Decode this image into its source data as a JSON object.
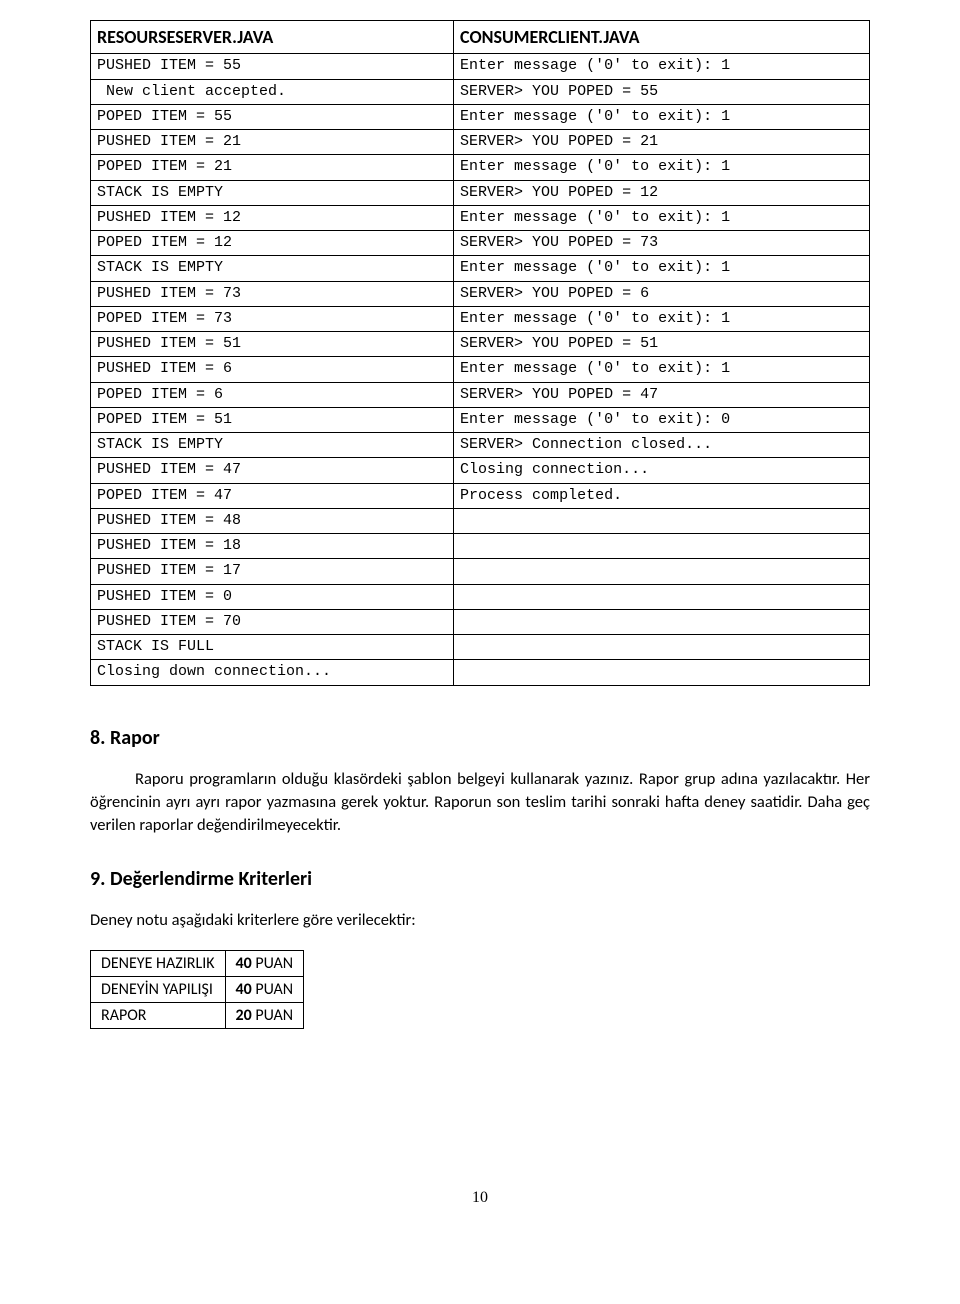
{
  "table1": {
    "headers": [
      "RESOURSESERVER.JAVA",
      "CONSUMERCLIENT.JAVA"
    ],
    "rows": [
      [
        "PUSHED ITEM = 55",
        "Enter message ('0' to exit): 1"
      ],
      [
        " New client accepted.",
        "SERVER> YOU POPED = 55"
      ],
      [
        "POPED ITEM = 55",
        "Enter message ('0' to exit): 1"
      ],
      [
        "PUSHED ITEM = 21",
        "SERVER> YOU POPED = 21"
      ],
      [
        "POPED ITEM = 21",
        "Enter message ('0' to exit): 1"
      ],
      [
        "STACK IS EMPTY",
        "SERVER> YOU POPED = 12"
      ],
      [
        "PUSHED ITEM = 12",
        "Enter message ('0' to exit): 1"
      ],
      [
        "POPED ITEM = 12",
        "SERVER> YOU POPED = 73"
      ],
      [
        "STACK IS EMPTY",
        "Enter message ('0' to exit): 1"
      ],
      [
        "PUSHED ITEM = 73",
        "SERVER> YOU POPED = 6"
      ],
      [
        "POPED ITEM = 73",
        "Enter message ('0' to exit): 1"
      ],
      [
        "PUSHED ITEM = 51",
        "SERVER> YOU POPED = 51"
      ],
      [
        "PUSHED ITEM = 6",
        "Enter message ('0' to exit): 1"
      ],
      [
        "POPED ITEM = 6",
        "SERVER> YOU POPED = 47"
      ],
      [
        "POPED ITEM = 51",
        "Enter message ('0' to exit): 0"
      ],
      [
        "STACK IS EMPTY",
        "SERVER> Connection closed..."
      ],
      [
        "PUSHED ITEM = 47",
        "Closing connection..."
      ],
      [
        "POPED ITEM = 47",
        "Process completed."
      ],
      [
        "PUSHED ITEM = 48",
        ""
      ],
      [
        "PUSHED ITEM = 18",
        ""
      ],
      [
        "PUSHED ITEM = 17",
        ""
      ],
      [
        "PUSHED ITEM = 0",
        ""
      ],
      [
        "PUSHED ITEM = 70",
        ""
      ],
      [
        "STACK IS FULL",
        ""
      ],
      [
        "Closing down connection...",
        ""
      ]
    ]
  },
  "section8": {
    "heading": "8. Rapor",
    "paragraph": "Raporu programların olduğu klasördeki şablon belgeyi kullanarak yazınız. Rapor grup adına yazılacaktır. Her öğrencinin ayrı ayrı rapor yazmasına gerek yoktur. Raporun son teslim tarihi sonraki hafta deney saatidir. Daha geç verilen raporlar değendirilmeyecektir."
  },
  "section9": {
    "heading": "9. Değerlendirme Kriterleri",
    "intro": "Deney notu aşağıdaki kriterlere göre verilecektir:",
    "criteria": [
      {
        "label": "DENEYE HAZIRLIK",
        "points_num": "40",
        "points_unit": " PUAN"
      },
      {
        "label": "DENEYİN YAPILIŞI",
        "points_num": "40",
        "points_unit": " PUAN"
      },
      {
        "label": "RAPOR",
        "points_num": "20",
        "points_unit": " PUAN"
      }
    ]
  },
  "page_number": "10"
}
